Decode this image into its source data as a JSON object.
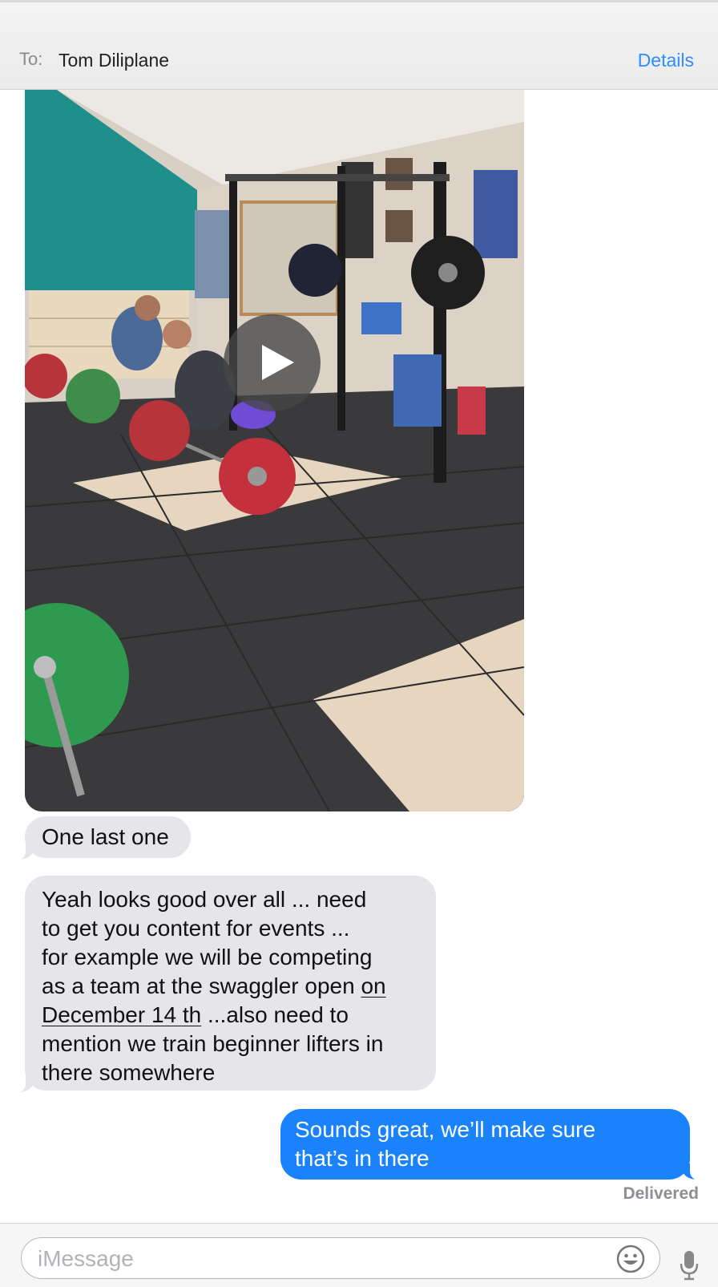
{
  "header": {
    "to_label": "To:",
    "recipient": "Tom Diliplane",
    "details_label": "Details"
  },
  "video": {
    "play_icon": "play-icon"
  },
  "messages": [
    {
      "direction": "incoming",
      "text": "One last one"
    },
    {
      "direction": "incoming",
      "line1": "Yeah looks good over all ... need",
      "line2": "to get you content for events ...",
      "line3": "for example we will be competing",
      "line4_pre": "as a team at the swaggler open ",
      "line4_link": "on",
      "line5_link": "December 14 th",
      "line5_post": " ...also need to",
      "line6": "mention we train beginner lifters in",
      "line7": "there somewhere"
    },
    {
      "direction": "outgoing",
      "line1": "Sounds great, we’ll make sure",
      "line2": "that’s in there"
    }
  ],
  "status": {
    "delivered": "Delivered"
  },
  "composer": {
    "placeholder": "iMessage",
    "emoji_icon": "emoji-icon",
    "mic_icon": "microphone-icon"
  },
  "colors": {
    "accent": "#2d8cff",
    "outgoing_bubble": "#1a82fb",
    "incoming_bubble": "#e5e5ea"
  }
}
